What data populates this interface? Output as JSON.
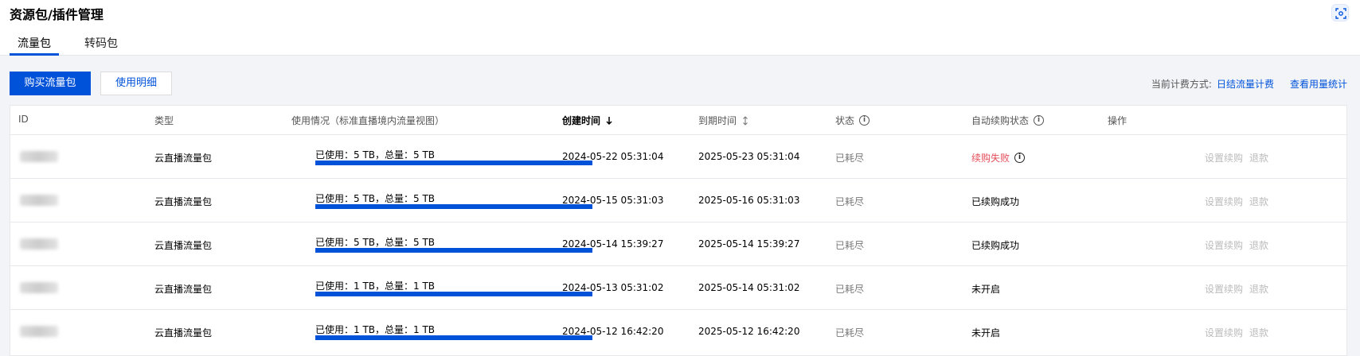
{
  "page_title": "资源包/插件管理",
  "tabs": [
    {
      "label": "流量包",
      "active": true
    },
    {
      "label": "转码包",
      "active": false
    }
  ],
  "toolbar": {
    "buy_label": "购买流量包",
    "detail_label": "使用明细"
  },
  "billing": {
    "prefix": "当前计费方式:",
    "method": "日结流量计费",
    "stats_link": "查看用量统计"
  },
  "table": {
    "headers": {
      "id": "ID",
      "type": "类型",
      "usage": "使用情况（标准直播境内流量视图）",
      "created": "创建时间",
      "expire": "到期时间",
      "status": "状态",
      "auto_renew": "自动续购状态",
      "actions": "操作"
    },
    "rows": [
      {
        "type": "云直播流量包",
        "usage": "已使用：5 TB，总量：5 TB",
        "usage_fraction": 1.0,
        "created": "2024-05-22 05:31:04",
        "expire": "2025-05-23 05:31:04",
        "status": "已耗尽",
        "auto_renew": "续购失败",
        "renew_failed": true
      },
      {
        "type": "云直播流量包",
        "usage": "已使用：5 TB，总量：5 TB",
        "usage_fraction": 1.0,
        "created": "2024-05-15 05:31:03",
        "expire": "2025-05-16 05:31:03",
        "status": "已耗尽",
        "auto_renew": "已续购成功",
        "renew_failed": false
      },
      {
        "type": "云直播流量包",
        "usage": "已使用：5 TB，总量：5 TB",
        "usage_fraction": 1.0,
        "created": "2024-05-14 15:39:27",
        "expire": "2025-05-14 15:39:27",
        "status": "已耗尽",
        "auto_renew": "已续购成功",
        "renew_failed": false
      },
      {
        "type": "云直播流量包",
        "usage": "已使用：1 TB，总量：1 TB",
        "usage_fraction": 1.0,
        "created": "2024-05-13 05:31:02",
        "expire": "2025-05-14 05:31:02",
        "status": "已耗尽",
        "auto_renew": "未开启",
        "renew_failed": false
      },
      {
        "type": "云直播流量包",
        "usage": "已使用：1 TB，总量：1 TB",
        "usage_fraction": 1.0,
        "created": "2024-05-12 16:42:20",
        "expire": "2025-05-12 16:42:20",
        "status": "已耗尽",
        "auto_renew": "未开启",
        "renew_failed": false
      }
    ],
    "actions": {
      "set_renew": "设置续购",
      "refund": "退款"
    }
  },
  "colors": {
    "primary": "#0052d9",
    "error": "#e34d59"
  }
}
